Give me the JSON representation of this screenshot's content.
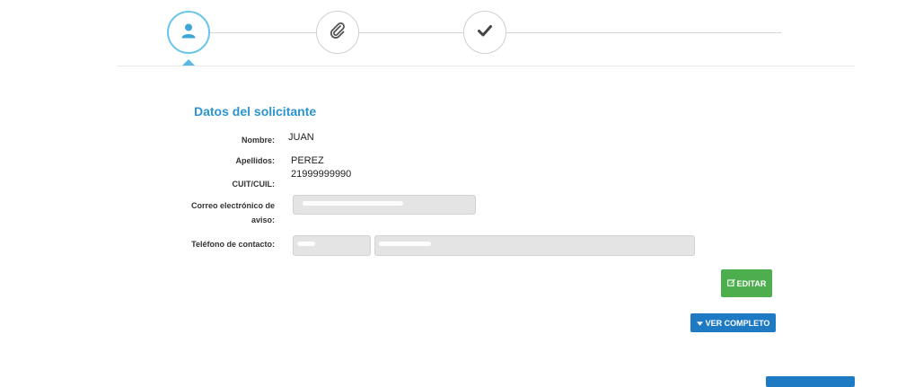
{
  "colors": {
    "accent": "#2b94d1",
    "active_step": "#6cc6e8",
    "edit_green": "#4cae4c",
    "primary_blue": "#1f7ac4"
  },
  "stepper": {
    "steps": [
      {
        "icon": "user-icon",
        "active": true
      },
      {
        "icon": "paperclip-icon",
        "active": false
      },
      {
        "icon": "checkmark-icon",
        "active": false
      }
    ]
  },
  "section": {
    "title": "Datos del solicitante"
  },
  "fields": {
    "nombre": {
      "label": "Nombre:",
      "value": "JUAN"
    },
    "apellidos": {
      "label": "Apellidos:",
      "value": "PEREZ"
    },
    "cuit": {
      "label": "CUIT/CUIL:",
      "value": "21999999990"
    },
    "correo": {
      "label_line1": "Correo electrónico de",
      "label_line2": "aviso:"
    },
    "telefono": {
      "label": "Teléfono de contacto:"
    }
  },
  "buttons": {
    "edit": "EDITAR",
    "ver_completo": "VER COMPLETO"
  }
}
